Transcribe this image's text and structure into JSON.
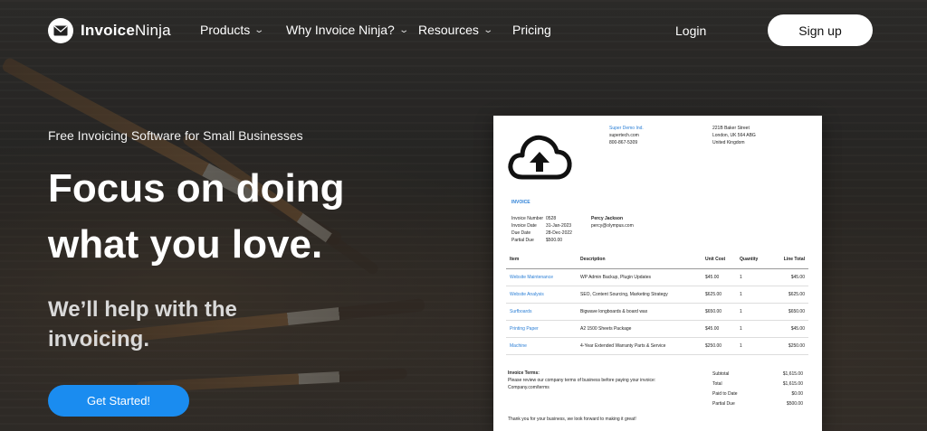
{
  "nav": {
    "logo_bold": "Invoice",
    "logo_thin": "Ninja",
    "products": "Products",
    "why": "Why Invoice Ninja?",
    "resources": "Resources",
    "pricing": "Pricing",
    "login": "Login",
    "signup": "Sign up"
  },
  "hero": {
    "tagline": "Free Invoicing Software for Small Businesses",
    "headline_1": "Focus on doing",
    "headline_2": "what you love.",
    "sub_1": "We’ll help with the",
    "sub_2": "invoicing.",
    "cta": "Get Started!"
  },
  "invoice": {
    "company_name": "Super Demo Ind.",
    "company_site": "supertech.com",
    "company_phone": "800-867-5309",
    "address_1": "221B Baker Street",
    "address_2": "London, UK 564 ABG",
    "address_3": "United Kingdom",
    "label": "INVOICE",
    "meta": [
      {
        "k": "Invoice Number",
        "v": "0528"
      },
      {
        "k": "Invoice Date",
        "v": "31-Jan-2023"
      },
      {
        "k": "Due Date",
        "v": "28-Dec-2022"
      },
      {
        "k": "Partial Due",
        "v": "$500.00"
      }
    ],
    "client_name": "Percy Jackson",
    "client_email": "percy@olympus.com",
    "columns": {
      "item": "Item",
      "desc": "Description",
      "cost": "Unit Cost",
      "qty": "Quantity",
      "total": "Line Total"
    },
    "rows": [
      {
        "item": "Website Maintenance",
        "desc": "WP Admin Backup, Plugin Updates",
        "cost": "$45.00",
        "qty": "1",
        "total": "$45.00"
      },
      {
        "item": "Website Analysis",
        "desc": "SEO, Content Sourcing, Marketing Strategy",
        "cost": "$625.00",
        "qty": "1",
        "total": "$625.00"
      },
      {
        "item": "Surfboards",
        "desc": "Bigwave longboards & board wax",
        "cost": "$650.00",
        "qty": "1",
        "total": "$650.00"
      },
      {
        "item": "Printing Paper",
        "desc": "A2 1500 Sheets Package",
        "cost": "$45.00",
        "qty": "1",
        "total": "$45.00"
      },
      {
        "item": "Machine",
        "desc": "4-Year Extended Warranty Parts & Service",
        "cost": "$250.00",
        "qty": "1",
        "total": "$250.00"
      }
    ],
    "terms_title": "Invoice Terms:",
    "terms_text": "Please review our company terms of business before paying your invoice: Company.com/terms",
    "totals": [
      {
        "k": "Subtotal",
        "v": "$1,615.00"
      },
      {
        "k": "Total",
        "v": "$1,615.00"
      },
      {
        "k": "Paid to Date",
        "v": "$0.00"
      },
      {
        "k": "Partial Due",
        "v": "$500.00"
      }
    ],
    "thanks": "Thank you for your business, we look forward to making it great!"
  },
  "colors": {
    "accent": "#1a8cf0",
    "link": "#2b7fd6"
  }
}
